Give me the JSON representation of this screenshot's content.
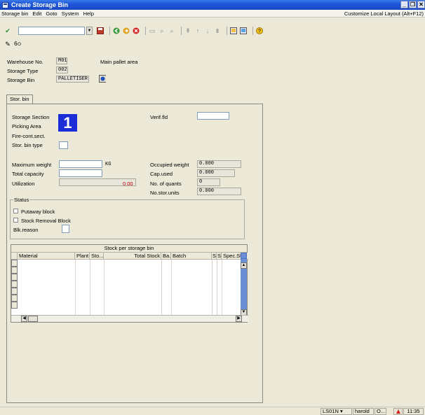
{
  "window": {
    "title": "Create Storage Bin"
  },
  "menu": {
    "items": [
      "Storage bin",
      "Edit",
      "Goto",
      "System",
      "Help"
    ],
    "customize": "Customize Local Layout (Alt+F12)"
  },
  "header": {
    "warehouse_label": "Warehouse No.",
    "warehouse_value": "M01",
    "warehouse_desc": "Main pallet area",
    "storage_type_label": "Storage Type",
    "storage_type_value": "002",
    "storage_bin_label": "Storage Bin",
    "storage_bin_value": "PALLETISER"
  },
  "tab": {
    "label": "Stor. bin"
  },
  "form": {
    "storage_section": "Storage Section",
    "picking_area": "Picking Area",
    "fire_cont": "Fire-cont.sect.",
    "bin_type": "Stor. bin type",
    "verif_fld": "Verif.fld",
    "marker": "1",
    "max_weight": "Maximum weight",
    "max_weight_unit": "KG",
    "total_capacity": "Total capacity",
    "utilization": "Utilization",
    "utilization_value": "0.00",
    "occupied_weight": "Occupied weight",
    "occupied_weight_value": "0.000",
    "cap_used": "Cap.used",
    "cap_used_value": "0.000",
    "no_quants": "No. of quants",
    "no_quants_value": "0",
    "no_stor_units": "No.stor.units",
    "no_stor_units_value": "0.000"
  },
  "status": {
    "title": "Status",
    "putaway_block": "Putaway block",
    "stock_removal_block": "Stock Removal Block",
    "blk_reason": "Blk.reason"
  },
  "table": {
    "caption": "Stock per storage bin",
    "columns": [
      "Material",
      "Plant",
      "Sto...",
      "Total Stock",
      "Ba...",
      "Batch",
      "S",
      "S",
      "Spec.Stock"
    ]
  },
  "statusbar": {
    "transaction": "LS01N",
    "user": "harold",
    "mode": "O...",
    "time": "11:35"
  },
  "colors": {
    "titlebar": "#1f56d8",
    "marker": "#1b2dd6",
    "scrollbar": "#6b8fd6",
    "utilization_red": "#c00000"
  }
}
